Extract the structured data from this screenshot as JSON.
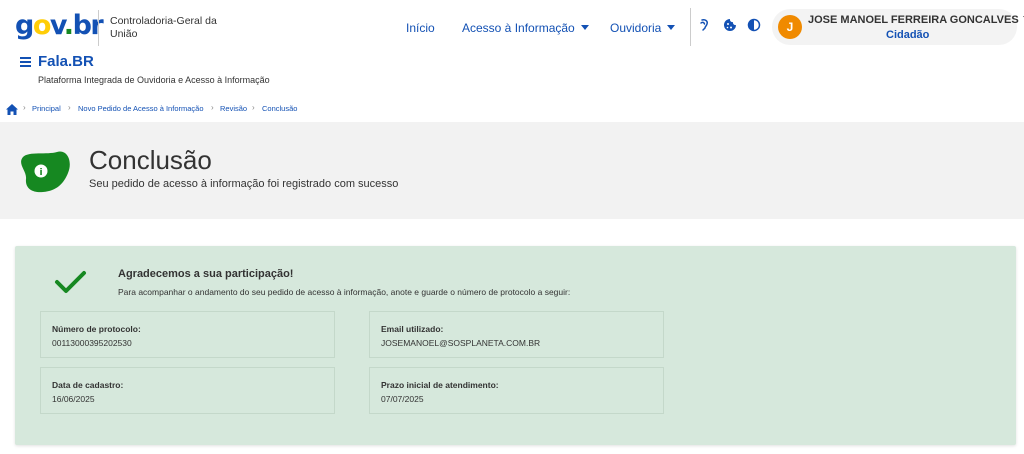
{
  "header": {
    "logo": {
      "g": "g",
      "o1": "o",
      "v": "v",
      "dot": ".",
      "br": "br"
    },
    "organization": "Controladoria-Geral da União",
    "nav": [
      {
        "label": "Início"
      },
      {
        "label": "Acesso à Informação"
      },
      {
        "label": "Ouvidoria"
      }
    ],
    "tools": [
      {
        "icon": "sign-language-icon"
      },
      {
        "icon": "cookie-icon"
      },
      {
        "icon": "contrast-icon"
      }
    ],
    "user": {
      "initial": "J",
      "name": "JOSE MANOEL FERREIRA GONCALVES",
      "role": "Cidadão"
    },
    "app_title": "Fala.BR",
    "app_subtitle": "Plataforma Integrada de Ouvidoria e Acesso à Informação"
  },
  "breadcrumb": {
    "items": [
      "Principal",
      "Novo Pedido de Acesso à Informação",
      "Revisão",
      "Conclusão"
    ]
  },
  "hero": {
    "title": "Conclusão",
    "subtitle": "Seu pedido de acesso à informação foi registrado com sucesso",
    "icon_glyph": "i"
  },
  "confirmation": {
    "title": "Agradecemos a sua participação!",
    "text": "Para acompanhar o andamento do seu pedido de acesso à informação, anote e guarde o número de protocolo a seguir:",
    "fields": [
      {
        "label": "Número de protocolo:",
        "value": "00113000395202530"
      },
      {
        "label": "Email utilizado:",
        "value": "JOSEMANOEL@SOSPLANETA.COM.BR"
      },
      {
        "label": "Data de cadastro:",
        "value": "16/06/2025"
      },
      {
        "label": "Prazo inicial de atendimento:",
        "value": "07/07/2025"
      }
    ]
  },
  "colors": {
    "primary": "#1351b4",
    "success_green": "#168821",
    "panel_bg": "#d6e8dc",
    "avatar": "#f08a00"
  }
}
